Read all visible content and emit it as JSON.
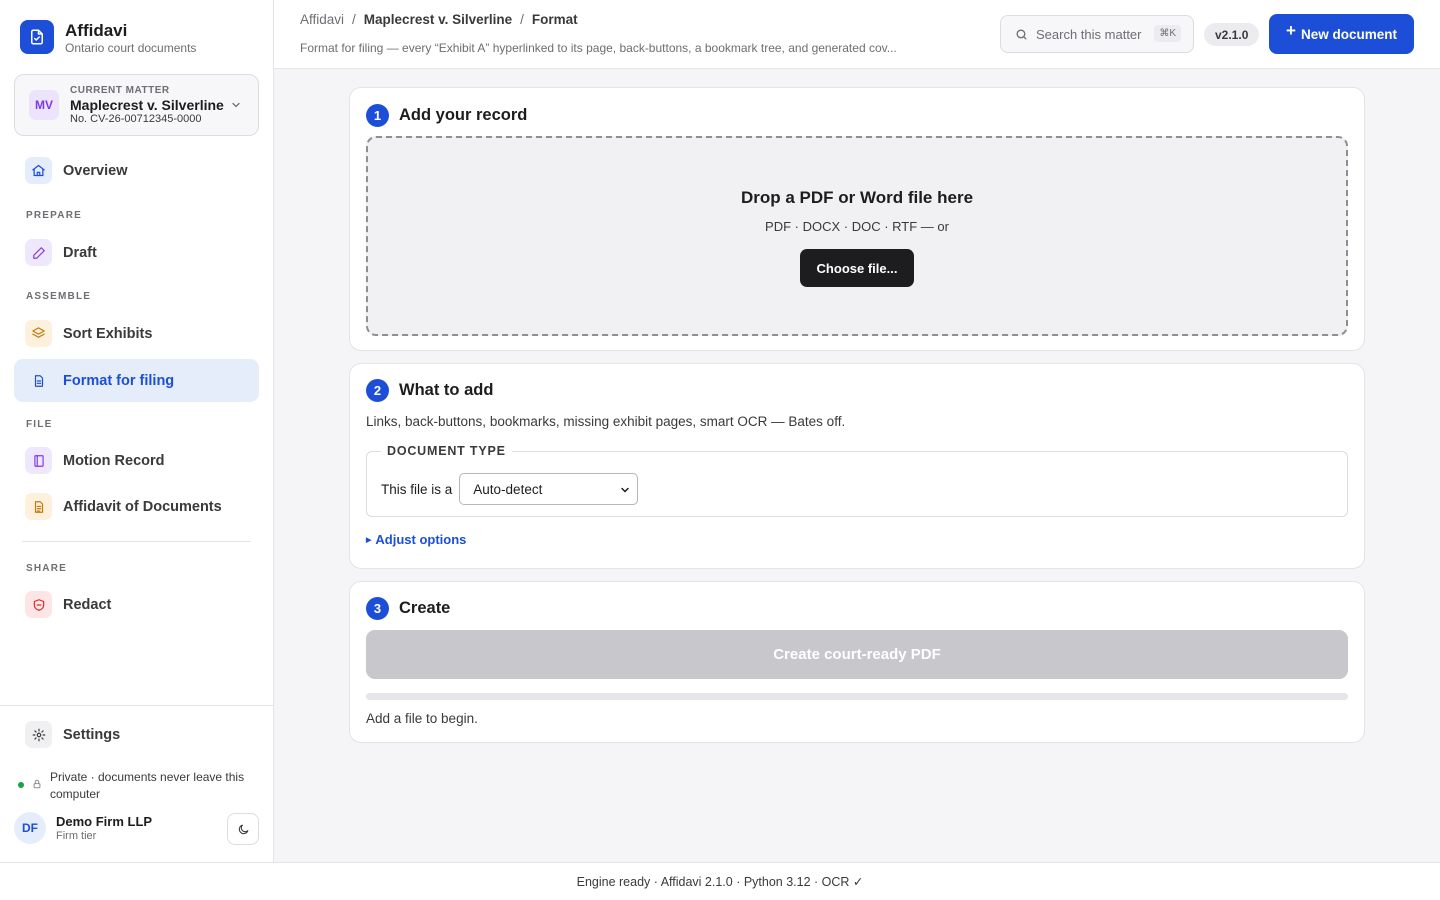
{
  "brand": {
    "name": "Affidavi",
    "subtitle": "Ontario court documents"
  },
  "matter": {
    "kicker": "CURRENT MATTER",
    "initials": "MV",
    "name": "Maplecrest v. Silverline",
    "number": "No. CV-26-00712345-0000"
  },
  "sidebar": {
    "overview": "Overview",
    "sections": {
      "prepare": "PREPARE",
      "assemble": "ASSEMBLE",
      "file": "FILE",
      "share": "SHARE"
    },
    "items": {
      "draft": "Draft",
      "sort_exhibits": "Sort Exhibits",
      "format_for_filing": "Format for filing",
      "motion_record": "Motion Record",
      "affidavit_of_documents": "Affidavit of Documents",
      "redact": "Redact",
      "settings": "Settings"
    },
    "active": "format_for_filing",
    "privacy": "Private · documents never leave this computer",
    "user": {
      "initials": "DF",
      "name": "Demo Firm LLP",
      "tier": "Firm tier"
    }
  },
  "header": {
    "breadcrumb": [
      "Affidavi",
      "Maplecrest v. Silverline",
      "Format"
    ],
    "subtitle": "Format for filing — every “Exhibit A” hyperlinked to its page, back-buttons, a bookmark tree, and generated cov...",
    "search_placeholder": "Search this matter",
    "search_shortcut": "⌘K",
    "version": "v2.1.0",
    "new_document": "New document"
  },
  "steps": {
    "add": {
      "number": "1",
      "title": "Add your record",
      "drop_title": "Drop a PDF or Word file here",
      "drop_sub": "PDF · DOCX · DOC · RTF — or",
      "choose": "Choose file..."
    },
    "what": {
      "number": "2",
      "title": "What to add",
      "description": "Links, back-buttons, bookmarks, missing exhibit pages, smart OCR — Bates off.",
      "legend": "DOCUMENT TYPE",
      "type_label": "This file is a",
      "type_value": "Auto-detect",
      "adjust": "Adjust options"
    },
    "create": {
      "number": "3",
      "title": "Create",
      "button": "Create court-ready PDF",
      "progress": 0,
      "status": "Add a file to begin."
    }
  },
  "footer": "Engine ready · Affidavi 2.1.0 · Python 3.12 · OCR ✓",
  "colors": {
    "accent": "#1d4ed8",
    "disabled": "#c7c7cc",
    "status_ok": "#16a34a"
  }
}
